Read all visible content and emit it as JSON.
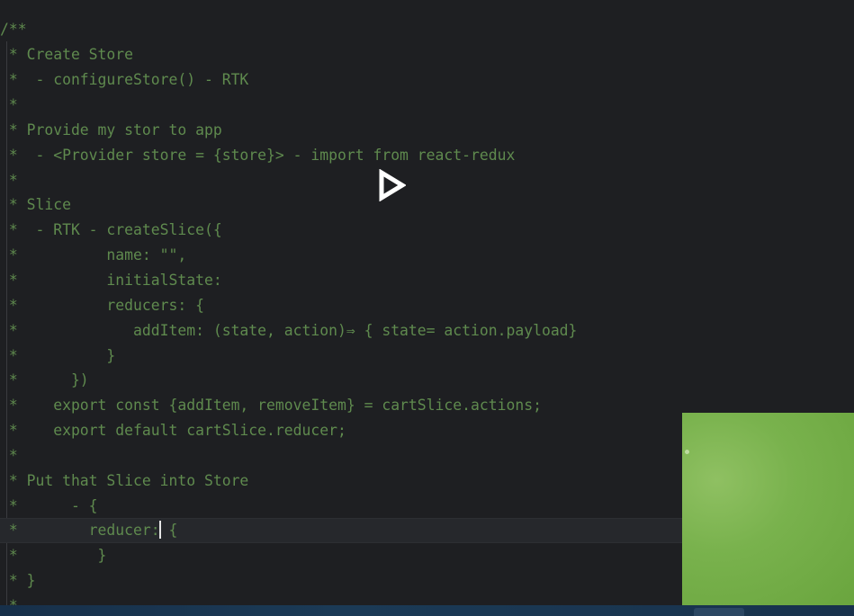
{
  "editor": {
    "lines": [
      "/**",
      " * Create Store",
      " *  - configureStore() - RTK",
      " *",
      " * Provide my stor to app",
      " *  - <Provider store = {store}> - import from react-redux",
      " *",
      " * Slice",
      " *  - RTK - createSlice({",
      " *          name: \"\",",
      " *          initialState:",
      " *          reducers: {",
      " *             addItem: (state, action)⇒ { state= action.payload}",
      " *          }",
      " *      })",
      " *    export const {addItem, removeItem} = cartSlice.actions;",
      " *    export default cartSlice.reducer;",
      " *",
      " * Put that Slice into Store",
      " *      - {",
      " *        reducer:",
      " *         }",
      " * }",
      " *"
    ],
    "current_line_after_caret": " {",
    "colors": {
      "background": "#1e1f22",
      "comment": "#5f8a4e",
      "current_line": "#26282c",
      "caret": "#e6e6e6"
    }
  },
  "overlay": {
    "play_icon": "play-icon",
    "webcam_color": "#79b24d"
  },
  "taskbar": {
    "color": "#1b3a56"
  }
}
